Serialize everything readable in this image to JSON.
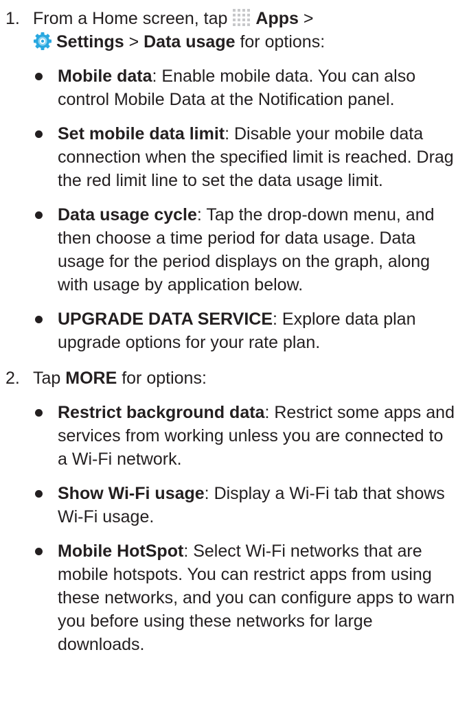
{
  "step1": {
    "number": "1.",
    "intro_pre": "From a Home screen, tap ",
    "apps_label": "Apps",
    "sep1": " >",
    "settings_label": "Settings",
    "sep2": " > ",
    "data_usage_label": "Data usage",
    "intro_post": " for options:",
    "icons": [
      "apps-grid-icon",
      "settings-gear-icon"
    ],
    "bullets": [
      {
        "term": "Mobile data",
        "text": ": Enable mobile data. You can also control Mobile Data at the Notification panel."
      },
      {
        "term": "Set mobile data limit",
        "text": ": Disable your mobile data connection when the specified limit is reached. Drag the red limit line to set the data usage limit."
      },
      {
        "term": "Data usage cycle",
        "text": ": Tap the drop-down menu, and then choose a time period for data usage. Data usage for the period displays on the graph, along with usage by application below."
      },
      {
        "term": "UPGRADE DATA SERVICE",
        "text": ": Explore data plan upgrade options for your rate plan."
      }
    ]
  },
  "step2": {
    "number": "2.",
    "intro_pre": "Tap ",
    "more_label": "MORE",
    "intro_post": " for options:",
    "bullets": [
      {
        "term": "Restrict background data",
        "text": ": Restrict some apps and services from working unless you are connected to a Wi-Fi network."
      },
      {
        "term": "Show Wi-Fi usage",
        "text": ": Display a Wi-Fi tab that shows Wi-Fi usage."
      },
      {
        "term": "Mobile HotSpot",
        "text": ": Select Wi-Fi networks that are mobile hotspots. You can restrict apps from using these networks, and you can configure apps to warn you before using these networks for large downloads."
      }
    ]
  },
  "colors": {
    "text": "#231f20",
    "apps_icon": "#c7c8ca",
    "settings_icon": "#29a8e0"
  }
}
